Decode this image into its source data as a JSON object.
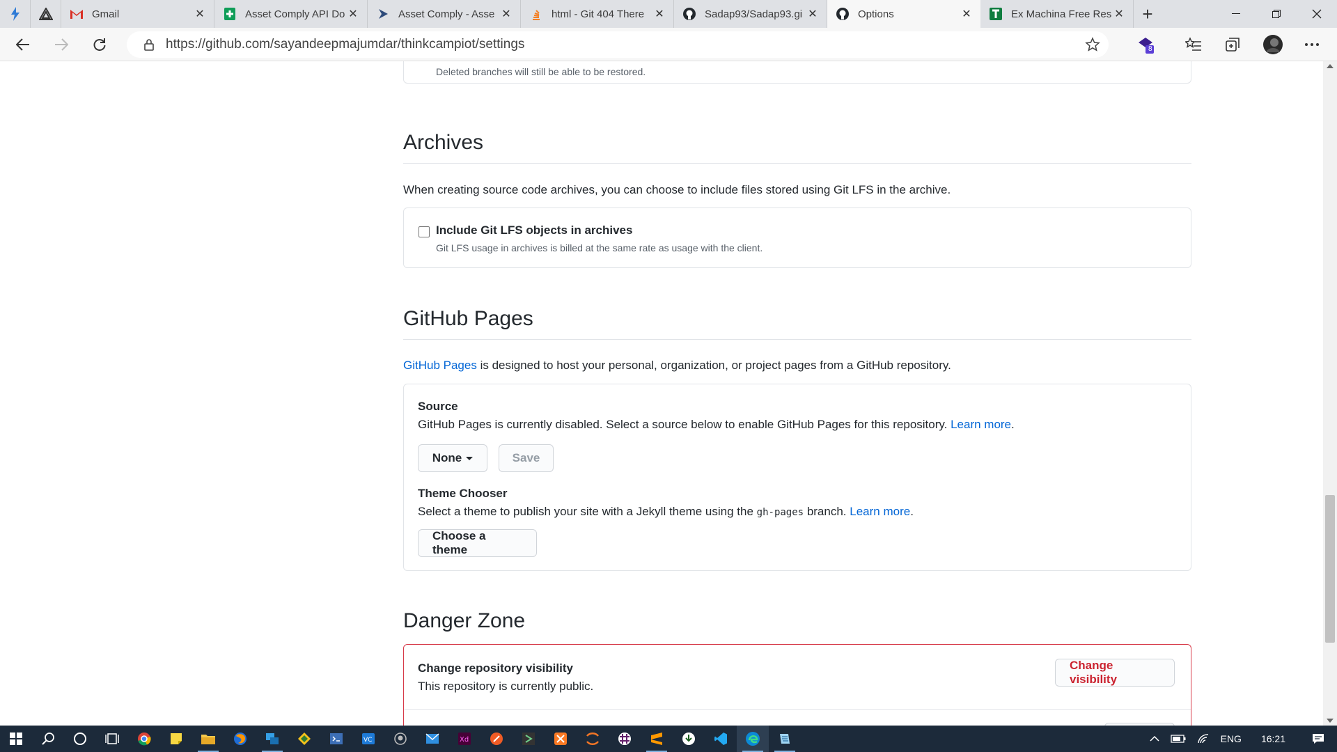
{
  "tabs": [
    {
      "title": "Gmail",
      "icon": "gmail-icon",
      "active": false
    },
    {
      "title": "Asset Comply API Do",
      "icon": "sheets-icon",
      "active": false
    },
    {
      "title": "Asset Comply - Asse",
      "icon": "play-icon",
      "active": false
    },
    {
      "title": "html - Git 404 There",
      "icon": "stackoverflow-icon",
      "active": false
    },
    {
      "title": "Sadap93/Sadap93.gi",
      "icon": "github-icon",
      "active": false
    },
    {
      "title": "Options",
      "icon": "github-icon",
      "active": true
    },
    {
      "title": "Ex Machina Free Res",
      "icon": "tableau-icon",
      "active": false
    }
  ],
  "address": {
    "url": "https://github.com/sayandeepmajumdar/thinkcampiot/settings",
    "extension_badge": "8"
  },
  "deleted_branches_note": "Deleted branches will still be able to be restored.",
  "archives": {
    "heading": "Archives",
    "description": "When creating source code archives, you can choose to include files stored using Git LFS in the archive.",
    "checkbox_label": "Include Git LFS objects in archives",
    "checkbox_checked": false,
    "checkbox_note": "Git LFS usage in archives is billed at the same rate as usage with the client."
  },
  "pages": {
    "heading": "GitHub Pages",
    "intro_link": "GitHub Pages",
    "intro_rest": " is designed to host your personal, organization, or project pages from a GitHub repository.",
    "source_label": "Source",
    "source_text": "GitHub Pages is currently disabled. Select a source below to enable GitHub Pages for this repository. ",
    "source_learn_more": "Learn more",
    "source_select": "None",
    "save_button": "Save",
    "theme_label": "Theme Chooser",
    "theme_text_before": "Select a theme to publish your site with a Jekyll theme using the ",
    "theme_code": "gh-pages",
    "theme_text_after": " branch. ",
    "theme_learn_more": "Learn more",
    "choose_theme_button": "Choose a theme"
  },
  "danger": {
    "heading": "Danger Zone",
    "border_color": "#d73a49",
    "visibility_label": "Change repository visibility",
    "visibility_text": "This repository is currently public.",
    "visibility_button": "Change visibility"
  },
  "tray": {
    "language": "ENG",
    "time": "16:21"
  }
}
